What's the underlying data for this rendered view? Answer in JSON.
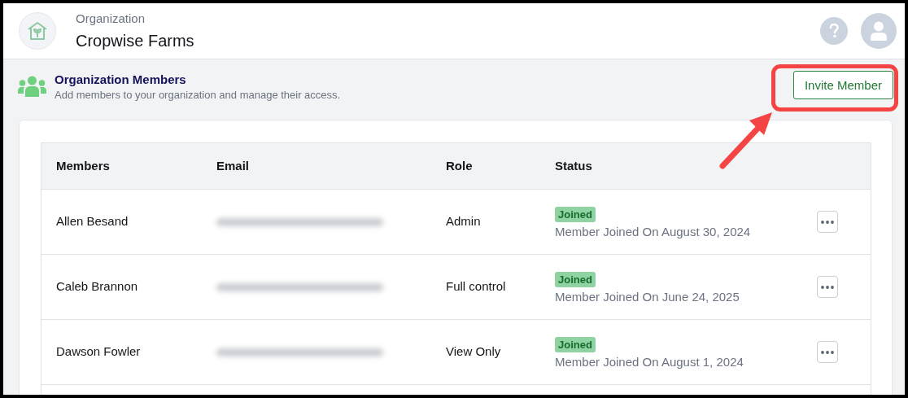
{
  "header": {
    "label": "Organization",
    "name": "Cropwise Farms"
  },
  "section": {
    "title": "Organization Members",
    "subtitle": "Add members to your organization and manage their access.",
    "button": "Invite Member"
  },
  "table": {
    "columns": [
      "Members",
      "Email",
      "Role",
      "Status"
    ],
    "rows": [
      {
        "member": "Allen Besand",
        "role": "Admin",
        "status": "Joined",
        "joined_text": "Member Joined On August 30, 2024"
      },
      {
        "member": "Caleb Brannon",
        "role": "Full control",
        "status": "Joined",
        "joined_text": "Member Joined On June 24, 2025"
      },
      {
        "member": "Dawson Fowler",
        "role": "View Only",
        "status": "Joined",
        "joined_text": "Member Joined On August 1, 2024"
      }
    ]
  }
}
